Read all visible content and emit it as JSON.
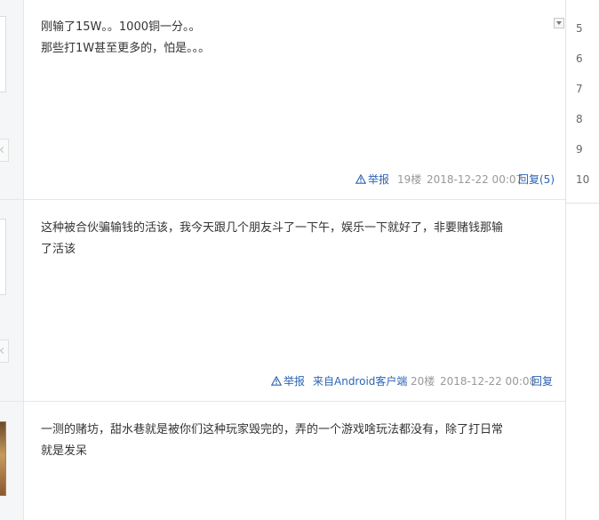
{
  "floors": [
    "5",
    "6",
    "7",
    "8",
    "9",
    "10"
  ],
  "posts": [
    {
      "lines": [
        "刚输了15W。。1000铜一分。。",
        "那些打1W甚至更多的，怕是。。。"
      ],
      "tail": {
        "report": "举报",
        "floor": "19楼",
        "time": "2018-12-22 00:07",
        "reply": "回复(5)"
      }
    },
    {
      "lines": [
        "这种被合伙骗输钱的活该，我今天跟几个朋友斗了一下午，娱乐一下就好了，非要赌钱那输",
        "了活该"
      ],
      "tail": {
        "report": "举报",
        "client": "来自Android客户端",
        "floor": "20楼",
        "time": "2018-12-22 00:08",
        "reply": "回复"
      }
    },
    {
      "lines": [
        "一测的赌坊，甜水巷就是被你们这种玩家毁完的，弄的一个游戏啥玩法都没有，除了打日常",
        "就是发呆"
      ]
    }
  ],
  "colors": {
    "link": "#2d64b3",
    "meta": "#999999",
    "text": "#333333",
    "divider": "#e7e7e7"
  },
  "icons": {
    "report": "warning-triangle-icon",
    "menu": "dropdown-arrow-icon"
  }
}
